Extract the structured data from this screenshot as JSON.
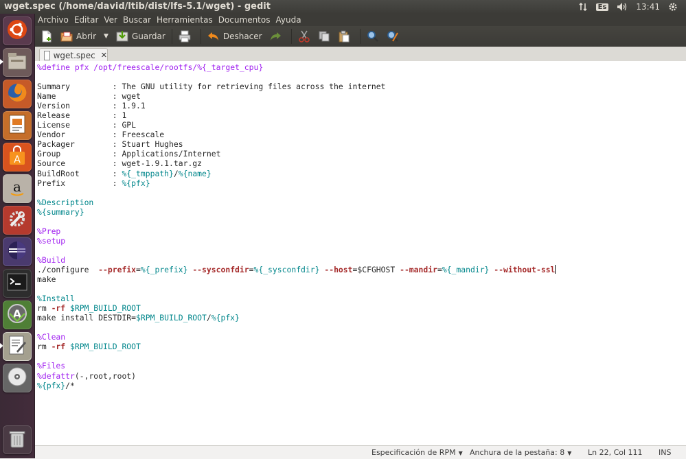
{
  "window": {
    "title": "wget.spec (/home/david/ltib/dist/lfs-5.1/wget) - gedit"
  },
  "panel": {
    "language": "Es",
    "clock": "13:41"
  },
  "menu": [
    "Archivo",
    "Editar",
    "Ver",
    "Buscar",
    "Herramientas",
    "Documentos",
    "Ayuda"
  ],
  "toolbar": {
    "open_label": "Abrir",
    "save_label": "Guardar",
    "undo_label": "Deshacer"
  },
  "tab": {
    "name": "wget.spec"
  },
  "code": [
    [
      [
        "%define",
        "dir"
      ],
      [
        " pfx /opt/freescale/rootfs/",
        "dir"
      ],
      [
        "%{_target_cpu}",
        "dir"
      ]
    ],
    [],
    [
      [
        "Summary         : The GNU utility for retrieving files across the internet",
        ""
      ]
    ],
    [
      [
        "Name            : wget",
        ""
      ]
    ],
    [
      [
        "Version         : 1.9.1",
        ""
      ]
    ],
    [
      [
        "Release         : 1",
        ""
      ]
    ],
    [
      [
        "License         : GPL",
        ""
      ]
    ],
    [
      [
        "Vendor          : Freescale",
        ""
      ]
    ],
    [
      [
        "Packager        : Stuart Hughes",
        ""
      ]
    ],
    [
      [
        "Group           : Applications/Internet",
        ""
      ]
    ],
    [
      [
        "Source          : wget-1.9.1.tar.gz",
        ""
      ]
    ],
    [
      [
        "BuildRoot       : ",
        ""
      ],
      [
        "%{_tmppath}",
        "var"
      ],
      [
        "/",
        ""
      ],
      [
        "%{name}",
        "var"
      ]
    ],
    [
      [
        "Prefix          : ",
        ""
      ],
      [
        "%{pfx}",
        "var"
      ]
    ],
    [],
    [
      [
        "%Description",
        "var"
      ]
    ],
    [
      [
        "%{summary}",
        "var"
      ]
    ],
    [],
    [
      [
        "%Prep",
        "dir"
      ]
    ],
    [
      [
        "%setup",
        "dir"
      ]
    ],
    [],
    [
      [
        "%Build",
        "dir"
      ]
    ],
    [
      [
        "./configure  ",
        ""
      ],
      [
        "--prefix",
        "opt"
      ],
      [
        "=",
        ""
      ],
      [
        "%{_prefix}",
        "var"
      ],
      [
        " ",
        ""
      ],
      [
        "--sysconfdir",
        "opt"
      ],
      [
        "=",
        ""
      ],
      [
        "%{_sysconfdir}",
        "var"
      ],
      [
        " ",
        ""
      ],
      [
        "--host",
        "opt"
      ],
      [
        "=$CFGHOST ",
        ""
      ],
      [
        "--mandir",
        "opt"
      ],
      [
        "=",
        ""
      ],
      [
        "%{_mandir}",
        "var"
      ],
      [
        " ",
        ""
      ],
      [
        "--without-ssl",
        "opt"
      ],
      [
        "",
        "caret"
      ]
    ],
    [
      [
        "make",
        ""
      ]
    ],
    [],
    [
      [
        "%Install",
        "var"
      ]
    ],
    [
      [
        "rm ",
        ""
      ],
      [
        "-rf",
        "opt"
      ],
      [
        " ",
        ""
      ],
      [
        "$RPM_BUILD_ROOT",
        "var"
      ]
    ],
    [
      [
        "make install DESTDIR=",
        ""
      ],
      [
        "$RPM_BUILD_ROOT",
        "var"
      ],
      [
        "/",
        ""
      ],
      [
        "%{pfx}",
        "var"
      ]
    ],
    [],
    [
      [
        "%Clean",
        "dir"
      ]
    ],
    [
      [
        "rm ",
        ""
      ],
      [
        "-rf",
        "opt"
      ],
      [
        " ",
        ""
      ],
      [
        "$RPM_BUILD_ROOT",
        "var"
      ]
    ],
    [],
    [
      [
        "%Files",
        "dir"
      ]
    ],
    [
      [
        "%defattr",
        "dir"
      ],
      [
        "(-,root,root)",
        ""
      ]
    ],
    [
      [
        "%{pfx}",
        "var"
      ],
      [
        "/*",
        ""
      ]
    ]
  ],
  "status": {
    "language": "Especificación de RPM",
    "tab_width": "Anchura de la pestaña: 8",
    "position": "Ln 22, Col 111",
    "mode": "INS"
  }
}
